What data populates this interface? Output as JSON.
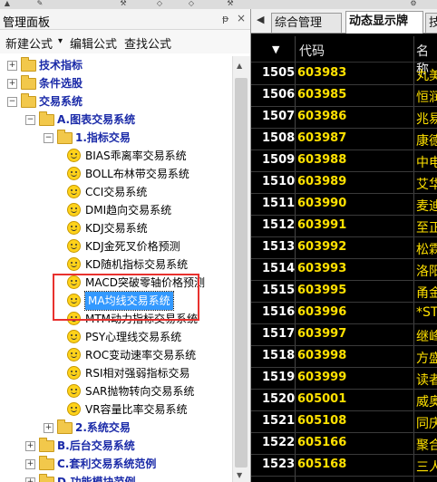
{
  "top_strip": {
    "icons": [
      "scrollbar-arrow-icon",
      "edit-icon",
      "tool-icon",
      "diamond-icon",
      "diamond-icon",
      "tool-icon",
      "settings-icon"
    ]
  },
  "left_panel": {
    "title": "管理面板",
    "pin_glyph": "ᵽ",
    "close_glyph": "×",
    "toolbar": {
      "new_formula": "新建公式",
      "dropdown_glyph": "▾",
      "edit_formula": "编辑公式",
      "find_formula": "查找公式"
    },
    "tree": [
      {
        "label": "技术指标",
        "bold": true,
        "expander": "+"
      },
      {
        "label": "条件选股",
        "bold": true,
        "expander": "+"
      },
      {
        "label": "交易系统",
        "bold": true,
        "expander": "−"
      },
      {
        "label": "A.图表交易系统",
        "bold": true,
        "expander": "−"
      },
      {
        "label": "1.指标交易",
        "bold": true,
        "expander": "−"
      },
      {
        "label": "BIAS乖离率交易系统"
      },
      {
        "label": "BOLL布林带交易系统"
      },
      {
        "label": "CCI交易系统"
      },
      {
        "label": "DMI趋向交易系统"
      },
      {
        "label": "KDJ交易系统"
      },
      {
        "label": "KDJ金死叉价格预测"
      },
      {
        "label": "KD随机指标交易系统"
      },
      {
        "label": "MACD突破零轴价格预测"
      },
      {
        "label": "MA均线交易系统",
        "selected": true
      },
      {
        "label": "MTM动力指标交易系统"
      },
      {
        "label": "PSY心理线交易系统"
      },
      {
        "label": "ROC变动速率交易系统"
      },
      {
        "label": "RSI相对强弱指标交易"
      },
      {
        "label": "SAR抛物转向交易系统"
      },
      {
        "label": "VR容量比率交易系统"
      },
      {
        "label": "2.系统交易",
        "bold": true,
        "expander": "+"
      },
      {
        "label": "B.后台交易系统",
        "bold": true,
        "expander": "+"
      },
      {
        "label": "C.套利交易系统范例",
        "bold": true,
        "expander": "+"
      },
      {
        "label": "D.功能模块范例",
        "bold": true,
        "expander": "+"
      }
    ]
  },
  "right_panel": {
    "tab_arrow": "◀",
    "tabs": [
      {
        "label": "综合管理"
      },
      {
        "label": "动态显示牌",
        "active": true
      },
      {
        "label": "技"
      }
    ],
    "sort_glyph": "▼",
    "columns": [
      "代码",
      "名称"
    ],
    "rows": [
      {
        "idx": "1505",
        "code": "603983",
        "name": "丸美"
      },
      {
        "idx": "1506",
        "code": "603985",
        "name": "恒润"
      },
      {
        "idx": "1507",
        "code": "603986",
        "name": "兆易"
      },
      {
        "idx": "1508",
        "code": "603987",
        "name": "康德"
      },
      {
        "idx": "1509",
        "code": "603988",
        "name": "中电"
      },
      {
        "idx": "1510",
        "code": "603989",
        "name": "艾华"
      },
      {
        "idx": "1511",
        "code": "603990",
        "name": "麦迪"
      },
      {
        "idx": "1512",
        "code": "603991",
        "name": "至正"
      },
      {
        "idx": "1513",
        "code": "603992",
        "name": "松霖"
      },
      {
        "idx": "1514",
        "code": "603993",
        "name": "洛阳"
      },
      {
        "idx": "1515",
        "code": "603995",
        "name": "甬金"
      },
      {
        "idx": "1516",
        "code": "603996",
        "name": "*ST"
      },
      {
        "idx": "1517",
        "code": "603997",
        "name": "继峰"
      },
      {
        "idx": "1518",
        "code": "603998",
        "name": "方盛"
      },
      {
        "idx": "1519",
        "code": "603999",
        "name": "读者"
      },
      {
        "idx": "1520",
        "code": "605001",
        "name": "威奥"
      },
      {
        "idx": "1521",
        "code": "605108",
        "name": "同庆"
      },
      {
        "idx": "1522",
        "code": "605166",
        "name": "聚合"
      },
      {
        "idx": "1523",
        "code": "605168",
        "name": "三人"
      }
    ]
  },
  "colors": {
    "selection": "#3399ff",
    "code_yellow": "#ffe100",
    "highlight_box": "#e8312e",
    "folder": "#f2c84b",
    "tree_bold": "#1a2aa8"
  }
}
